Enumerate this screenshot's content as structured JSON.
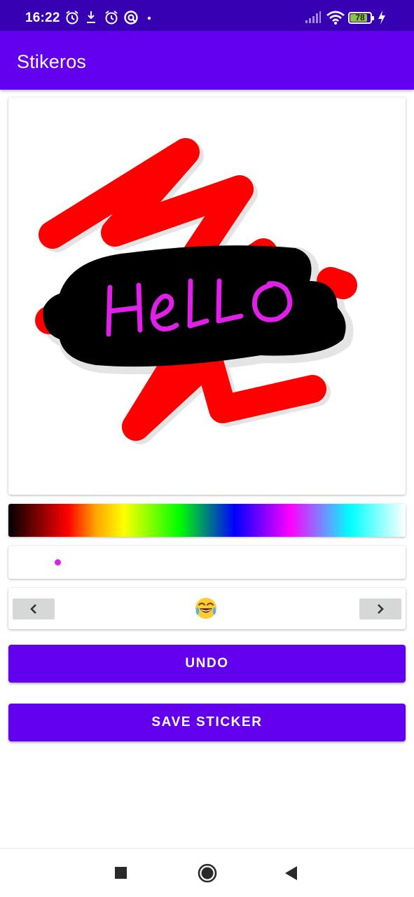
{
  "status_bar": {
    "time": "16:22",
    "battery_level": "78",
    "icons": [
      "alarm-icon",
      "download-icon",
      "alarm-icon",
      "vpn-icon",
      "dot-icon",
      "signal-icon",
      "wifi-icon",
      "battery-icon",
      "charging-icon"
    ]
  },
  "app_bar": {
    "title": "Stikeros"
  },
  "canvas": {
    "drawn_text": "HeLLO",
    "stroke_colors": [
      "#ff0000",
      "#000000",
      "#e020e8"
    ]
  },
  "color_picker": {
    "colors": [
      "#000000",
      "#ff0000",
      "#ffa500",
      "#ffff00",
      "#00ff00",
      "#0000ff",
      "#ff00ff",
      "#00ffff",
      "#ffffff"
    ]
  },
  "brush_size": {
    "color": "#e020e8"
  },
  "sticker_picker": {
    "prev_icon": "chevron-left-icon",
    "next_icon": "chevron-right-icon",
    "current_emoji": "😂"
  },
  "actions": {
    "undo_label": "UNDO",
    "save_label": "SAVE STICKER"
  },
  "colors": {
    "status_bar": "#3700b3",
    "primary": "#6200ee",
    "nav_button_bg": "#d6d7d7"
  },
  "system_nav": [
    "recents-icon",
    "home-icon",
    "back-icon"
  ]
}
